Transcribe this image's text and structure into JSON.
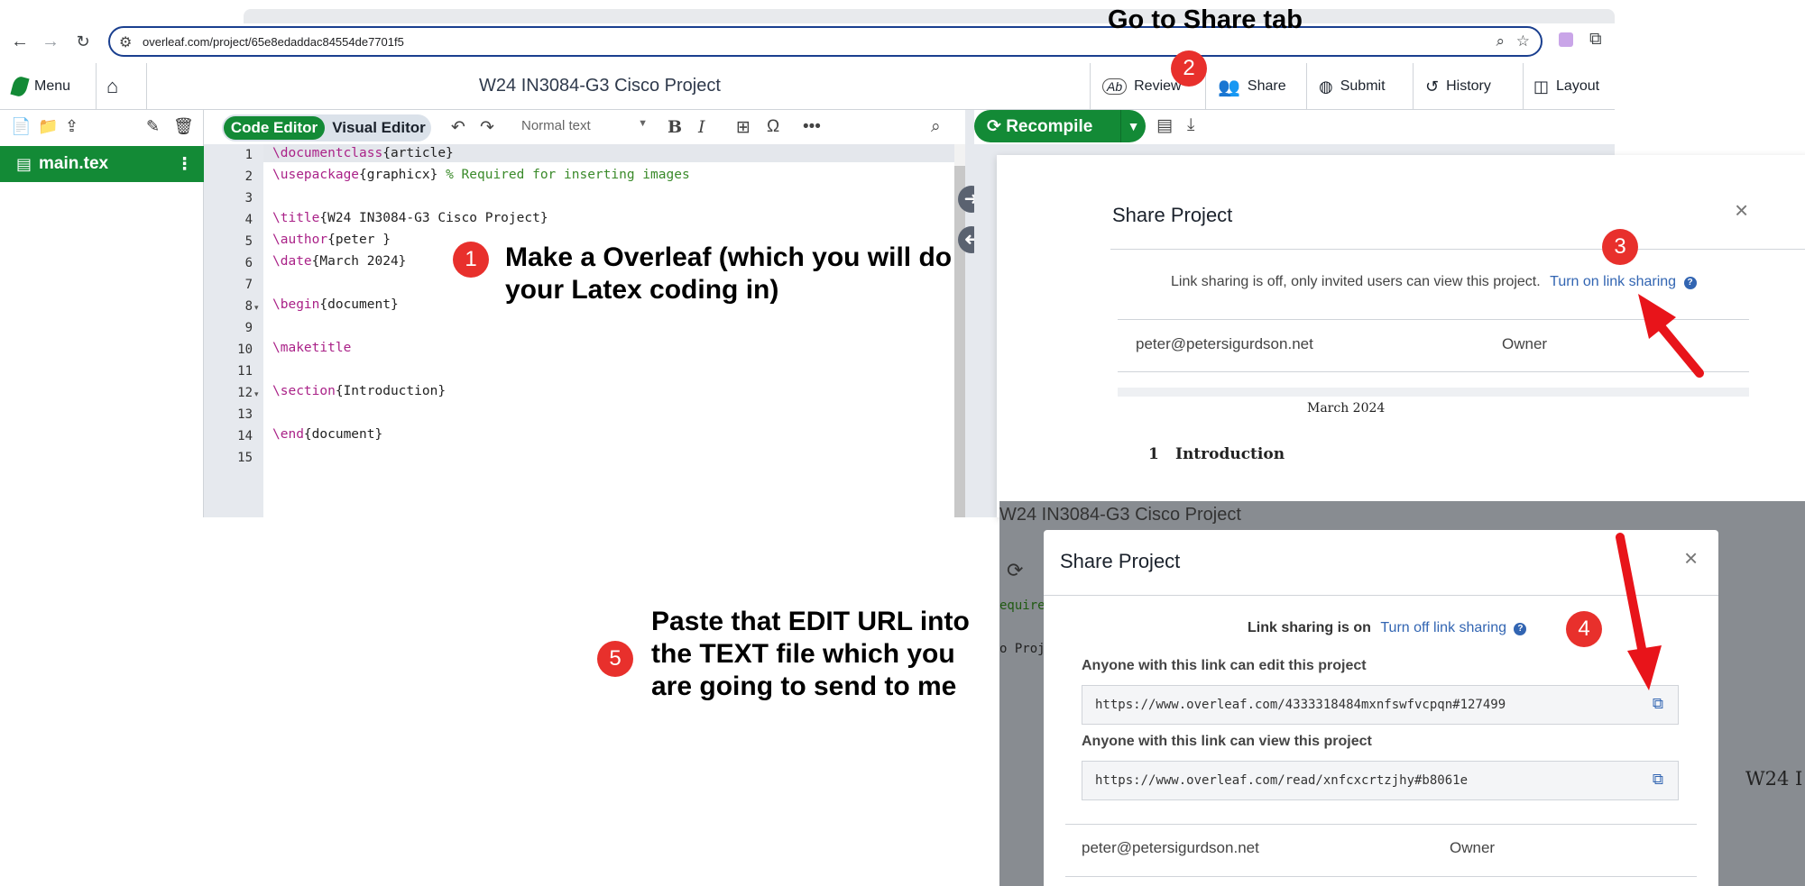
{
  "browser": {
    "url": "overleaf.com/project/65e8edaddac84554de7701f5"
  },
  "topbar": {
    "menu_label": "Menu",
    "project_title": "W24 IN3084-G3 Cisco Project",
    "review_label": "Review",
    "share_label": "Share",
    "submit_label": "Submit",
    "history_label": "History",
    "layout_label": "Layout"
  },
  "filetree": {
    "file_name": "main.tex"
  },
  "editor": {
    "code_editor_label": "Code Editor",
    "visual_editor_label": "Visual Editor",
    "style_select": "Normal text",
    "lines": [
      {
        "n": "1",
        "cmd": "\\documentclass",
        "rest": "{article}"
      },
      {
        "n": "2",
        "cmd": "\\usepackage",
        "rest": "{graphicx} ",
        "comment": "% Required for inserting images"
      },
      {
        "n": "3",
        "cmd": "",
        "rest": ""
      },
      {
        "n": "4",
        "cmd": "\\title",
        "rest": "{W24 IN3084-G3 Cisco Project}"
      },
      {
        "n": "5",
        "cmd": "\\author",
        "rest": "{peter }"
      },
      {
        "n": "6",
        "cmd": "\\date",
        "rest": "{March 2024}"
      },
      {
        "n": "7",
        "cmd": "",
        "rest": ""
      },
      {
        "n": "8",
        "cmd": "\\begin",
        "rest": "{document}"
      },
      {
        "n": "9",
        "cmd": "",
        "rest": ""
      },
      {
        "n": "10",
        "cmd": "\\maketitle",
        "rest": ""
      },
      {
        "n": "11",
        "cmd": "",
        "rest": ""
      },
      {
        "n": "12",
        "cmd": "\\section",
        "rest": "{Introduction}"
      },
      {
        "n": "13",
        "cmd": "",
        "rest": ""
      },
      {
        "n": "14",
        "cmd": "\\end",
        "rest": "{document}"
      },
      {
        "n": "15",
        "cmd": "",
        "rest": ""
      }
    ]
  },
  "pdf": {
    "recompile_label": "Recompile"
  },
  "share_modal_off": {
    "title": "Share Project",
    "status_text": "Link sharing is off, only invited users can view this project.",
    "toggle_link": "Turn on link sharing",
    "owner_email": "peter@petersigurdson.net",
    "owner_role": "Owner",
    "preview_date": "March 2024",
    "preview_section_num": "1",
    "preview_section_title": "Introduction"
  },
  "share_modal_on": {
    "background_title": "W24 IN3084-G3 Cisco Project",
    "background_code_1": "equire",
    "background_code_2": "o Proj",
    "background_pdf_text": "W24 I",
    "title": "Share Project",
    "status_text": "Link sharing is on",
    "toggle_link": "Turn off link sharing",
    "edit_label": "Anyone with this link can edit this project",
    "edit_url": "https://www.overleaf.com/4333318484mxnfswfvcpqn#127499",
    "view_label": "Anyone with this link can view this project",
    "view_url": "https://www.overleaf.com/read/xnfcxcrtzjhy#b8061e",
    "owner_email": "peter@petersigurdson.net",
    "owner_role": "Owner"
  },
  "annotations": {
    "step1_num": "1",
    "step1_text": "Make a Overleaf (which you will do your Latex coding in)",
    "step2_num": "2",
    "step2_text": "Go to Share tab",
    "step3_num": "3",
    "step4_num": "4",
    "step5_num": "5",
    "step5_text": "Paste that EDIT URL into the TEXT file which you are going to send to me"
  },
  "colors": {
    "overleaf_green": "#138a36",
    "link_blue": "#3265b2",
    "badge_red": "#e8302c"
  }
}
